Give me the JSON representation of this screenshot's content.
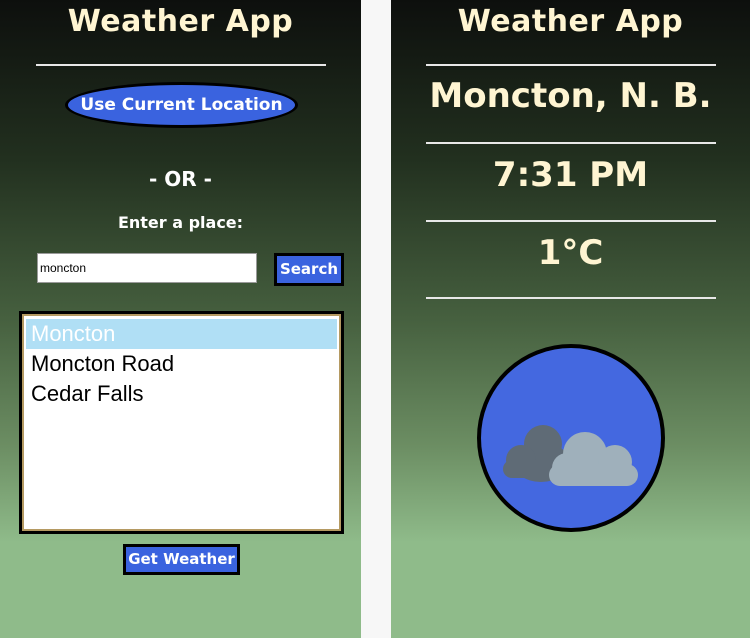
{
  "left": {
    "title": "Weather App",
    "location_button": "Use Current Location",
    "or_text": "- OR -",
    "place_label": "Enter a place:",
    "search_input": {
      "value": "moncton",
      "placeholder": ""
    },
    "search_button": "Search",
    "results": [
      {
        "label": "Moncton",
        "selected": true
      },
      {
        "label": "Moncton Road",
        "selected": false
      },
      {
        "label": "Cedar Falls",
        "selected": false
      }
    ],
    "get_weather_button": "Get Weather"
  },
  "right": {
    "title": "Weather App",
    "city": "Moncton, N. B.",
    "time": "7:31 PM",
    "temperature": "1°C",
    "weather_icon": "night-cloudy-moon-icon"
  },
  "colors": {
    "title_text": "#fff5d2",
    "button_blue": "#3a63df",
    "selected_item": "#b0dff5",
    "icon_circle": "#4468e0"
  }
}
